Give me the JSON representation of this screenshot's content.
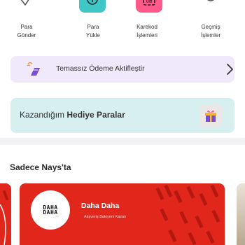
{
  "quick_actions": [
    {
      "label": "Para\nGönder",
      "icon": "send-check-icon"
    },
    {
      "label": "Para\nYükle",
      "icon": "top-up-icon"
    },
    {
      "label": "Karekod\nİşlemleri",
      "icon": "qr-code-icon"
    },
    {
      "label": "Geçmiş\nİşlemler",
      "icon": "history-icon"
    }
  ],
  "quick_action_labels": {
    "send_line1": "Para",
    "send_line2": "Gönder",
    "topup_line1": "Para",
    "topup_line2": "Yükle",
    "qr_line1": "Karekod",
    "qr_line2": "İşlemleri",
    "history_line1": "Geçmiş",
    "history_line2": "İşlemler"
  },
  "promo_banner": {
    "text": "Temassız Ödeme Aktifleştir",
    "icon": "contactless-payment-icon"
  },
  "gift_banner": {
    "prefix": "Kazandığım ",
    "bold": "Hediye Paralar",
    "icon": "gift-icon"
  },
  "section": {
    "title": "Sadece Nays'ta"
  },
  "featured_card": {
    "title": "Daha Daha",
    "subtitle": "Alışveriş Bakiyeni Kazan",
    "logo_text_line1": "DAHA",
    "logo_text_line2": "DAHA",
    "icon": "daha-daha-logo-icon"
  },
  "colors": {
    "accent_purple": "#7a4bd6",
    "teal": "#3fc7c7",
    "pink": "#ff5a8a",
    "card_red": "#e1261c",
    "promo_bg": "#efe9fb",
    "gift_bg": "#d7efef"
  }
}
